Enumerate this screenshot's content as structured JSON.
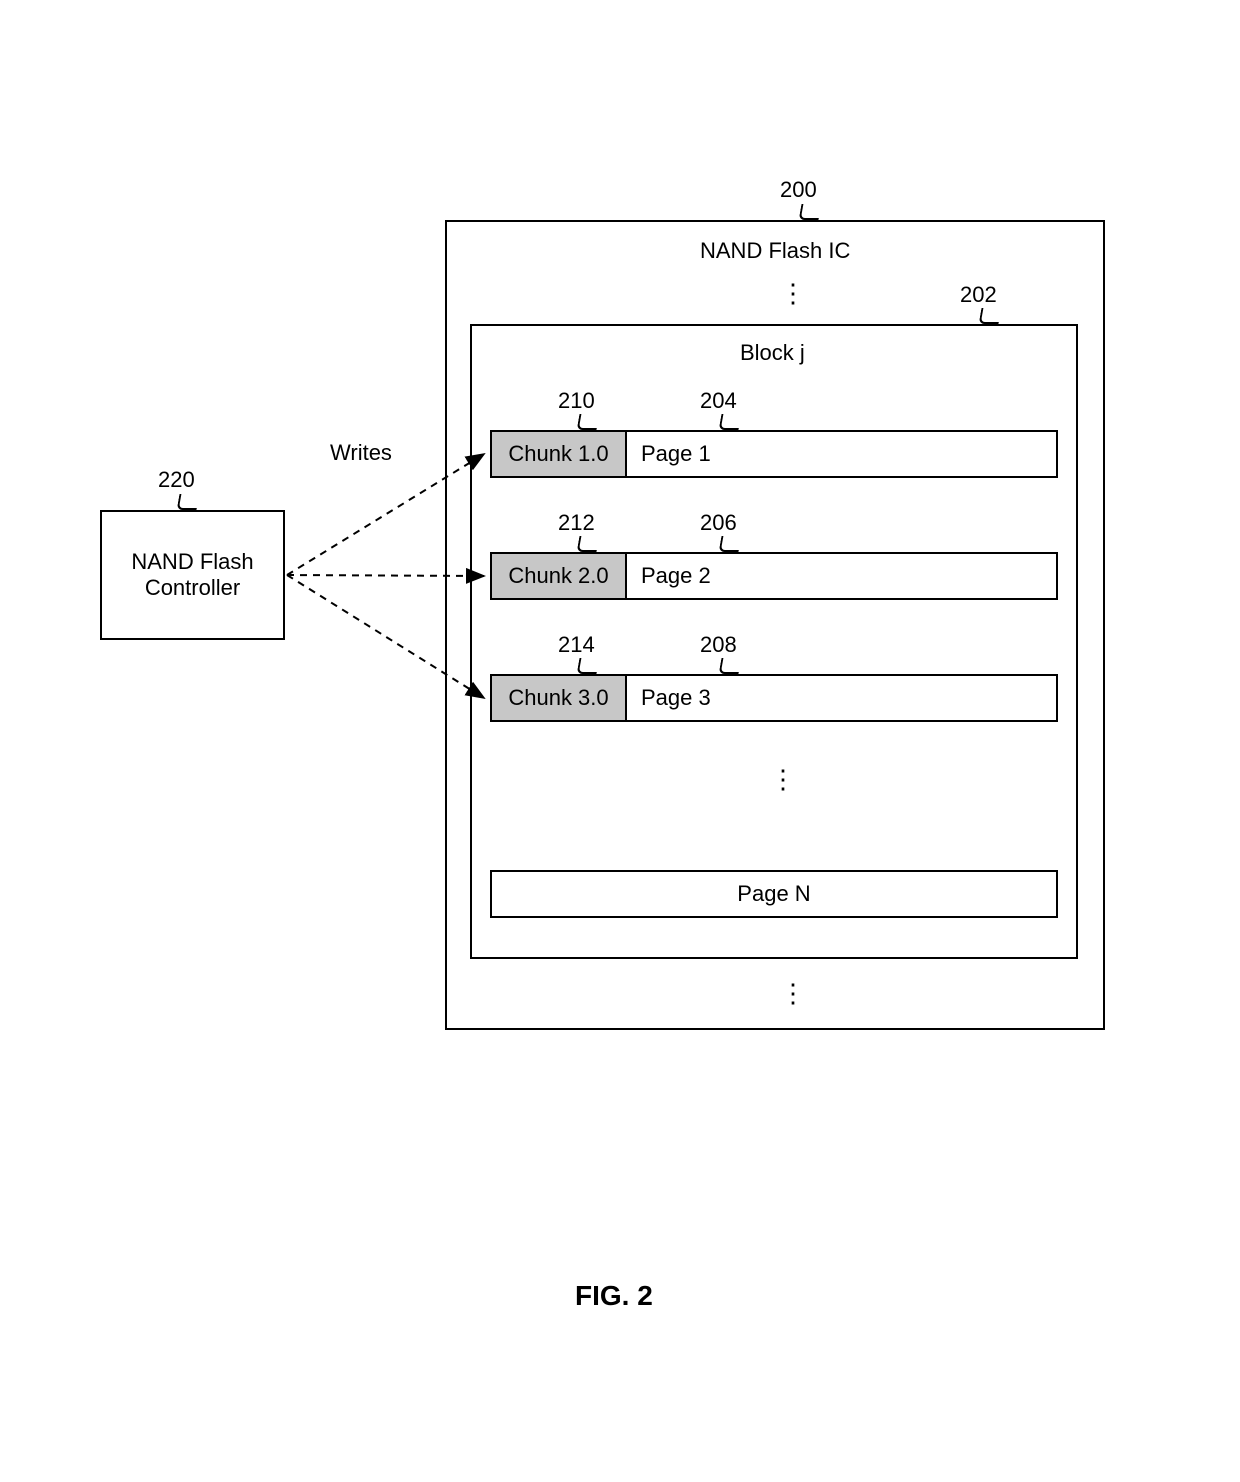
{
  "figure_caption": "FIG. 2",
  "controller": {
    "ref": "220",
    "label_line1": "NAND Flash",
    "label_line2": "Controller"
  },
  "writes_label": "Writes",
  "ic": {
    "ref": "200",
    "title": "NAND Flash IC"
  },
  "block": {
    "ref": "202",
    "title": "Block j"
  },
  "rows": [
    {
      "chunk_ref": "210",
      "page_ref": "204",
      "chunk_label": "Chunk 1.0",
      "page_label": "Page 1"
    },
    {
      "chunk_ref": "212",
      "page_ref": "206",
      "chunk_label": "Chunk 2.0",
      "page_label": "Page 2"
    },
    {
      "chunk_ref": "214",
      "page_ref": "208",
      "chunk_label": "Chunk 3.0",
      "page_label": "Page 3"
    }
  ],
  "page_n_label": "Page N"
}
